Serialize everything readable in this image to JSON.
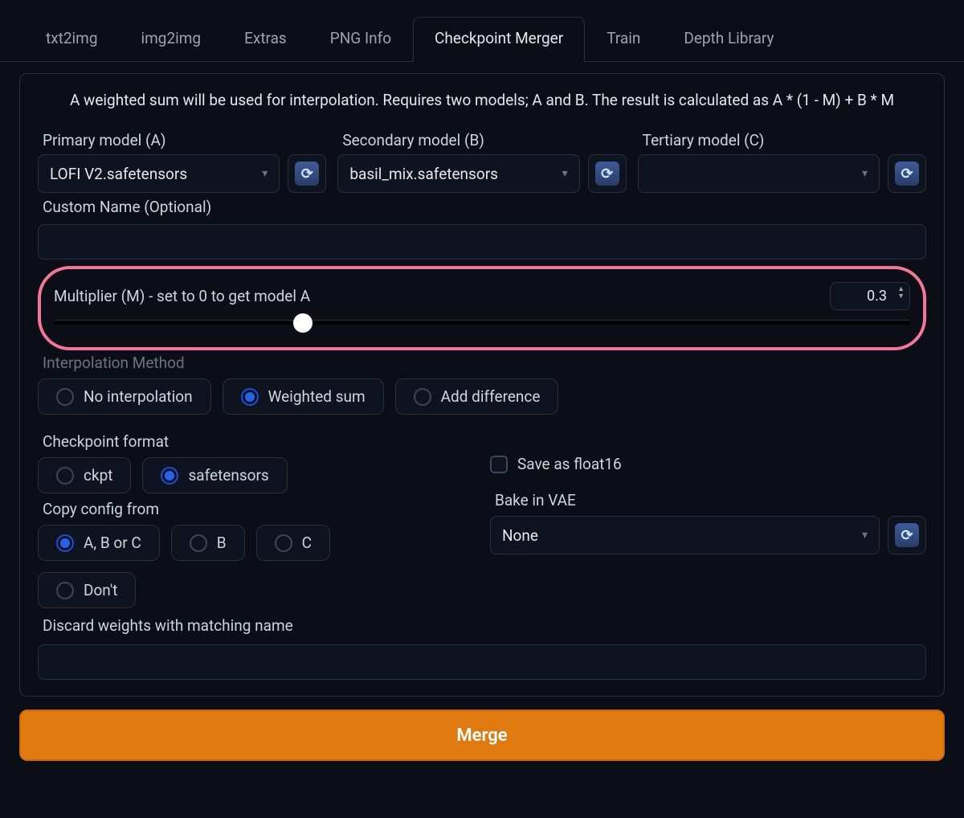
{
  "tabs": {
    "txt2img": "txt2img",
    "img2img": "img2img",
    "extras": "Extras",
    "pnginfo": "PNG Info",
    "checkpoint_merger": "Checkpoint Merger",
    "train": "Train",
    "depth_library": "Depth Library",
    "active": "checkpoint_merger"
  },
  "description": "A weighted sum will be used for interpolation. Requires two models; A and B. The result is calculated as A * (1 - M) + B * M",
  "models": {
    "primary_label": "Primary model (A)",
    "primary_value": "LOFI V2.safetensors",
    "secondary_label": "Secondary model (B)",
    "secondary_value": "basil_mix.safetensors",
    "tertiary_label": "Tertiary model (C)",
    "tertiary_value": ""
  },
  "custom_name": {
    "label": "Custom Name (Optional)",
    "value": ""
  },
  "multiplier": {
    "label": "Multiplier (M) - set to 0 to get model A",
    "value": "0.3"
  },
  "interpolation": {
    "label": "Interpolation Method",
    "options": {
      "none": "No interpolation",
      "weighted": "Weighted sum",
      "diff": "Add difference"
    },
    "selected": "weighted"
  },
  "checkpoint_format": {
    "label": "Checkpoint format",
    "options": {
      "ckpt": "ckpt",
      "safetensors": "safetensors"
    },
    "selected": "safetensors"
  },
  "save_float16": {
    "label": "Save as float16",
    "checked": false
  },
  "copy_config": {
    "label": "Copy config from",
    "options": {
      "abc": "A, B or C",
      "b": "B",
      "c": "C",
      "dont": "Don't"
    },
    "selected": "abc"
  },
  "bake_vae": {
    "label": "Bake in VAE",
    "value": "None"
  },
  "discard": {
    "label": "Discard weights with matching name",
    "value": ""
  },
  "merge_button": "Merge"
}
